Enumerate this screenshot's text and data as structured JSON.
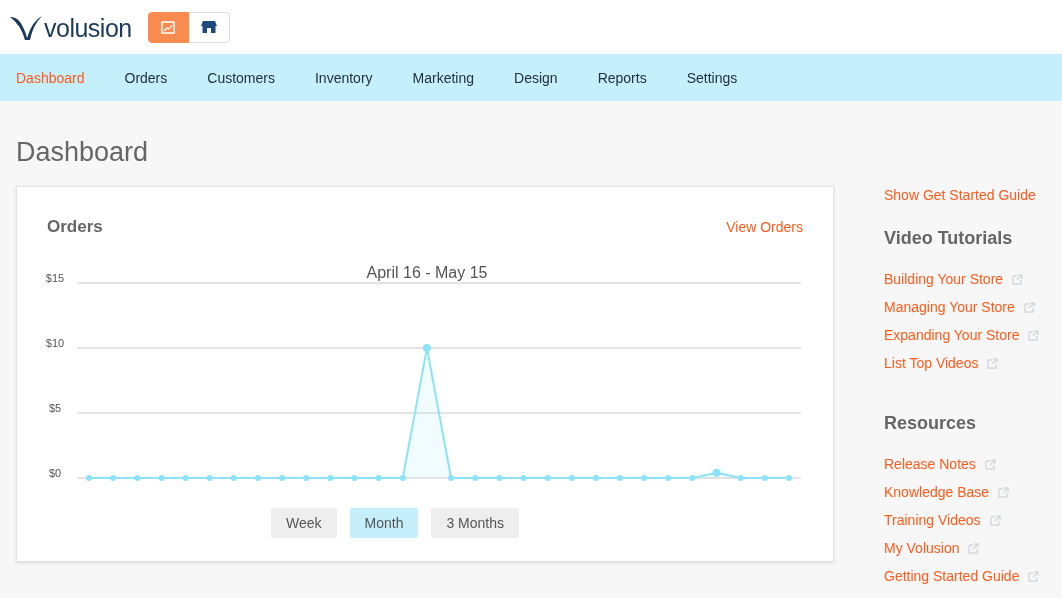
{
  "logo": {
    "text": "volusion"
  },
  "mode_buttons": [
    {
      "kind": "chart",
      "selected": true
    },
    {
      "kind": "store",
      "selected": false
    }
  ],
  "nav": [
    {
      "label": "Dashboard",
      "selected": true
    },
    {
      "label": "Orders",
      "selected": false
    },
    {
      "label": "Customers",
      "selected": false
    },
    {
      "label": "Inventory",
      "selected": false
    },
    {
      "label": "Marketing",
      "selected": false
    },
    {
      "label": "Design",
      "selected": false
    },
    {
      "label": "Reports",
      "selected": false
    },
    {
      "label": "Settings",
      "selected": false
    }
  ],
  "page_title": "Dashboard",
  "orders_card": {
    "title": "Orders",
    "link": "View Orders",
    "chart_data": {
      "type": "area",
      "title": "April 16 - May 15",
      "series": [
        {
          "color": "#8ce3f7",
          "values": [
            0,
            0,
            0,
            0,
            0,
            0,
            0,
            0,
            0,
            0,
            0,
            0,
            0,
            0,
            10,
            0,
            0,
            0,
            0,
            0,
            0,
            0,
            0,
            0,
            0,
            0,
            0.4,
            0,
            0,
            0
          ]
        }
      ],
      "ylim": [
        0,
        15
      ],
      "yticks": [
        {
          "value": 0,
          "label": "$0"
        },
        {
          "value": 5,
          "label": "$5"
        },
        {
          "value": 10,
          "label": "$10"
        },
        {
          "value": 15,
          "label": "$15"
        }
      ]
    },
    "ranges": [
      {
        "label": "Week",
        "selected": false
      },
      {
        "label": "Month",
        "selected": true
      },
      {
        "label": "3 Months",
        "selected": false
      }
    ]
  },
  "sidebar": {
    "guide_link": "Show Get Started Guide",
    "sections": [
      {
        "title": "Video Tutorials",
        "links": [
          "Building Your Store",
          "Managing Your Store",
          "Expanding Your Store",
          "List Top Videos"
        ]
      },
      {
        "title": "Resources",
        "links": [
          "Release Notes",
          "Knowledge Base",
          "Training Videos",
          "My Volusion",
          "Getting Started Guide"
        ]
      }
    ]
  }
}
